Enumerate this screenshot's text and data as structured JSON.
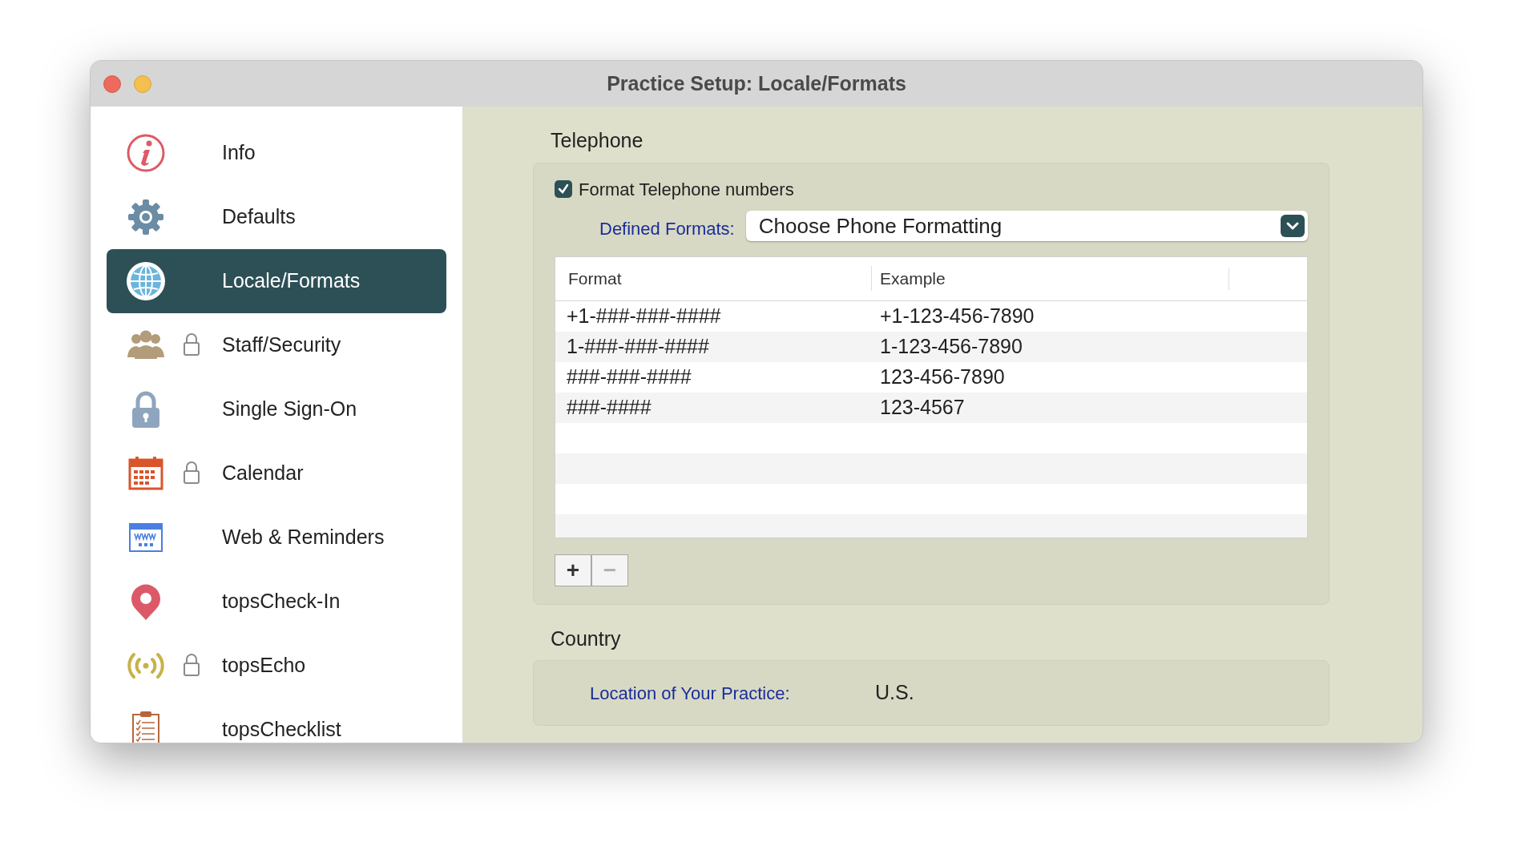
{
  "window": {
    "title": "Practice Setup: Locale/Formats"
  },
  "sidebar": {
    "items": [
      {
        "label": "Info",
        "kind": "info",
        "locked": false,
        "selected": false
      },
      {
        "label": "Defaults",
        "kind": "gear",
        "locked": false,
        "selected": false
      },
      {
        "label": "Locale/Formats",
        "kind": "globe",
        "locked": false,
        "selected": true
      },
      {
        "label": "Staff/Security",
        "kind": "people",
        "locked": true,
        "selected": false
      },
      {
        "label": "Single Sign-On",
        "kind": "padlock",
        "locked": false,
        "selected": false
      },
      {
        "label": "Calendar",
        "kind": "calendar",
        "locked": true,
        "selected": false
      },
      {
        "label": "Web & Reminders",
        "kind": "web",
        "locked": false,
        "selected": false
      },
      {
        "label": "topsCheck-In",
        "kind": "pin",
        "locked": false,
        "selected": false
      },
      {
        "label": "topsEcho",
        "kind": "broadcast",
        "locked": true,
        "selected": false
      },
      {
        "label": "topsChecklist",
        "kind": "clipboard",
        "locked": false,
        "selected": false
      }
    ]
  },
  "telephone": {
    "heading": "Telephone",
    "format_checkbox": {
      "label": "Format Telephone numbers",
      "checked": true
    },
    "defined_formats": {
      "label": "Defined Formats:",
      "value": "Choose Phone Formatting"
    },
    "table": {
      "columns": [
        "Format",
        "Example"
      ],
      "rows": [
        {
          "format": "+1-###-###-####",
          "example": "+1-123-456-7890"
        },
        {
          "format": "1-###-###-####",
          "example": "1-123-456-7890"
        },
        {
          "format": "###-###-####",
          "example": "123-456-7890"
        },
        {
          "format": "###-####",
          "example": "123-4567"
        }
      ]
    },
    "buttons": [
      {
        "label": "+",
        "disabled": false
      },
      {
        "label": "−",
        "disabled": true
      }
    ]
  },
  "country": {
    "heading": "Country",
    "label": "Location of Your Practice:",
    "value": "U.S."
  }
}
